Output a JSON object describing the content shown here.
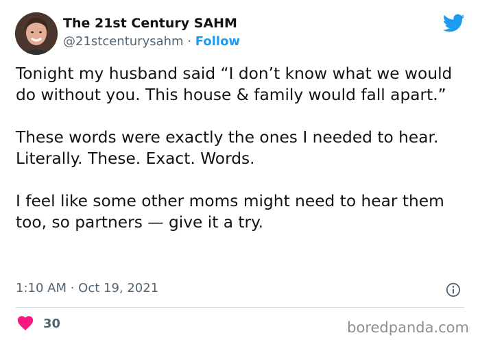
{
  "tweet": {
    "author_name": "The 21st Century SAHM",
    "handle": "@21stcenturysahm",
    "separator": "·",
    "follow_label": "Follow",
    "paragraphs": [
      [
        "Tonight my husband said “I don’t know what we would do without you. This house & family would fall apart.”"
      ],
      [
        "These words were exactly the ones I needed to hear.",
        "Literally. These. Exact. Words."
      ],
      [
        "I feel like some other moms might need to hear them too, so partners — give it a try."
      ]
    ],
    "timestamp": "1:10 AM · Oct 19, 2021",
    "like_count": "30"
  },
  "icons": {
    "brand": "twitter-bird-icon",
    "info": "info-icon",
    "like": "heart-icon"
  },
  "colors": {
    "accent": "#1d9bf0",
    "like": "#f91880",
    "text": "#0f1419",
    "secondary": "#536471"
  },
  "watermark": "boredpanda.com"
}
